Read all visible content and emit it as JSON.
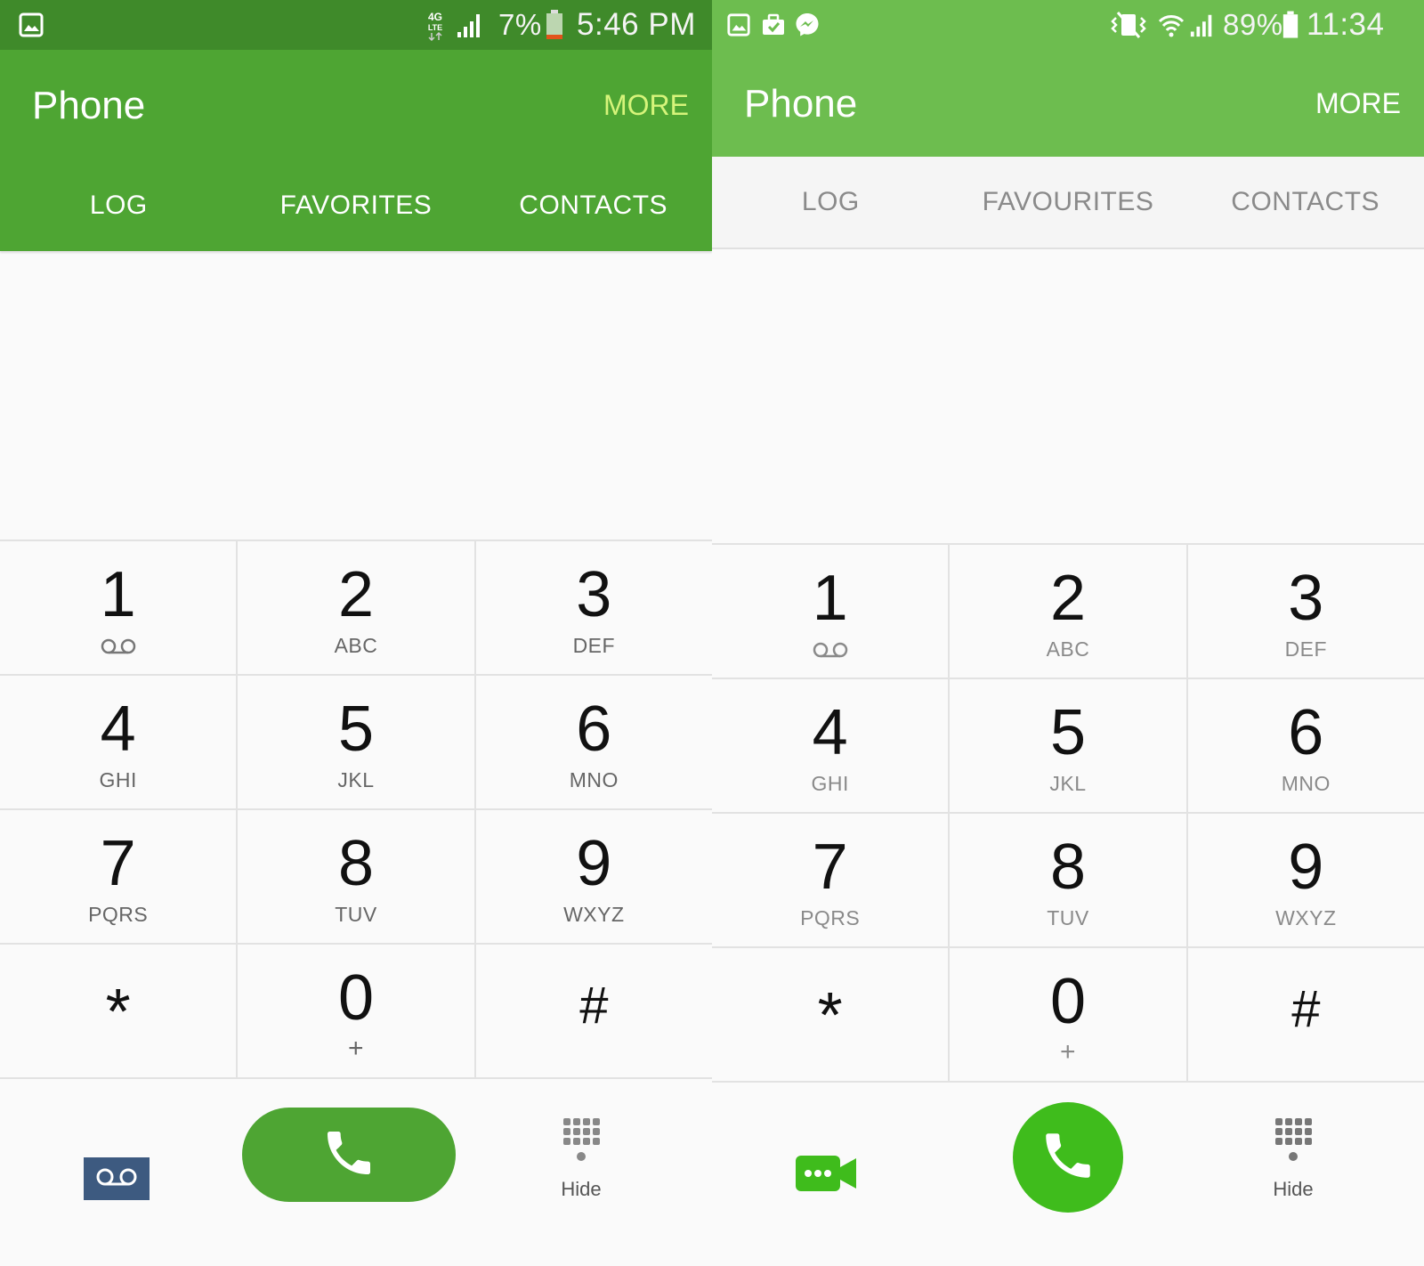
{
  "left": {
    "status": {
      "network": "4G LTE",
      "battery": "7%",
      "time": "5:46 PM"
    },
    "app": {
      "title": "Phone",
      "more": "MORE"
    },
    "tabs": [
      {
        "label": "LOG"
      },
      {
        "label": "FAVORITES"
      },
      {
        "label": "CONTACTS"
      }
    ],
    "keys": [
      {
        "digit": "1",
        "sub": ""
      },
      {
        "digit": "2",
        "sub": "ABC"
      },
      {
        "digit": "3",
        "sub": "DEF"
      },
      {
        "digit": "4",
        "sub": "GHI"
      },
      {
        "digit": "5",
        "sub": "JKL"
      },
      {
        "digit": "6",
        "sub": "MNO"
      },
      {
        "digit": "7",
        "sub": "PQRS"
      },
      {
        "digit": "8",
        "sub": "TUV"
      },
      {
        "digit": "9",
        "sub": "WXYZ"
      },
      {
        "digit": "*",
        "sub": ""
      },
      {
        "digit": "0",
        "sub": "+"
      },
      {
        "digit": "#",
        "sub": ""
      }
    ],
    "bottom": {
      "hide": "Hide"
    },
    "colors": {
      "status_bar": "#3f8a2a",
      "app_bar": "#4ea533",
      "more": "#d6f47a",
      "tab_text": "#ffffff",
      "call_button": "#4ea533",
      "voicemail_icon_bg": "#3d5a80"
    }
  },
  "right": {
    "status": {
      "battery": "89%",
      "time": "11:34"
    },
    "app": {
      "title": "Phone",
      "more": "MORE"
    },
    "tabs": [
      {
        "label": "LOG"
      },
      {
        "label": "FAVOURITES"
      },
      {
        "label": "CONTACTS"
      }
    ],
    "keys": [
      {
        "digit": "1",
        "sub": ""
      },
      {
        "digit": "2",
        "sub": "ABC"
      },
      {
        "digit": "3",
        "sub": "DEF"
      },
      {
        "digit": "4",
        "sub": "GHI"
      },
      {
        "digit": "5",
        "sub": "JKL"
      },
      {
        "digit": "6",
        "sub": "MNO"
      },
      {
        "digit": "7",
        "sub": "PQRS"
      },
      {
        "digit": "8",
        "sub": "TUV"
      },
      {
        "digit": "9",
        "sub": "WXYZ"
      },
      {
        "digit": "*",
        "sub": ""
      },
      {
        "digit": "0",
        "sub": "+"
      },
      {
        "digit": "#",
        "sub": ""
      }
    ],
    "bottom": {
      "hide": "Hide"
    },
    "colors": {
      "status_bar": "#6dbd4f",
      "app_bar": "#6dbd4f",
      "more": "#ffffff",
      "tab_bar": "#f5f5f5",
      "tab_text": "#8a8a8a",
      "call_button": "#3fbc1c",
      "video_icon": "#3fbc1c"
    }
  },
  "icons": {
    "left_status": [
      "gallery-icon",
      "lte-icon",
      "signal-icon",
      "battery-low-icon"
    ],
    "right_status": [
      "gallery-icon",
      "briefcase-icon",
      "messenger-icon",
      "vibrate-icon",
      "wifi-icon",
      "signal-icon",
      "battery-icon"
    ],
    "left_bottom": [
      "voicemail-icon",
      "call-icon",
      "keypad-icon"
    ],
    "right_bottom": [
      "video-call-icon",
      "call-icon",
      "keypad-icon"
    ]
  }
}
